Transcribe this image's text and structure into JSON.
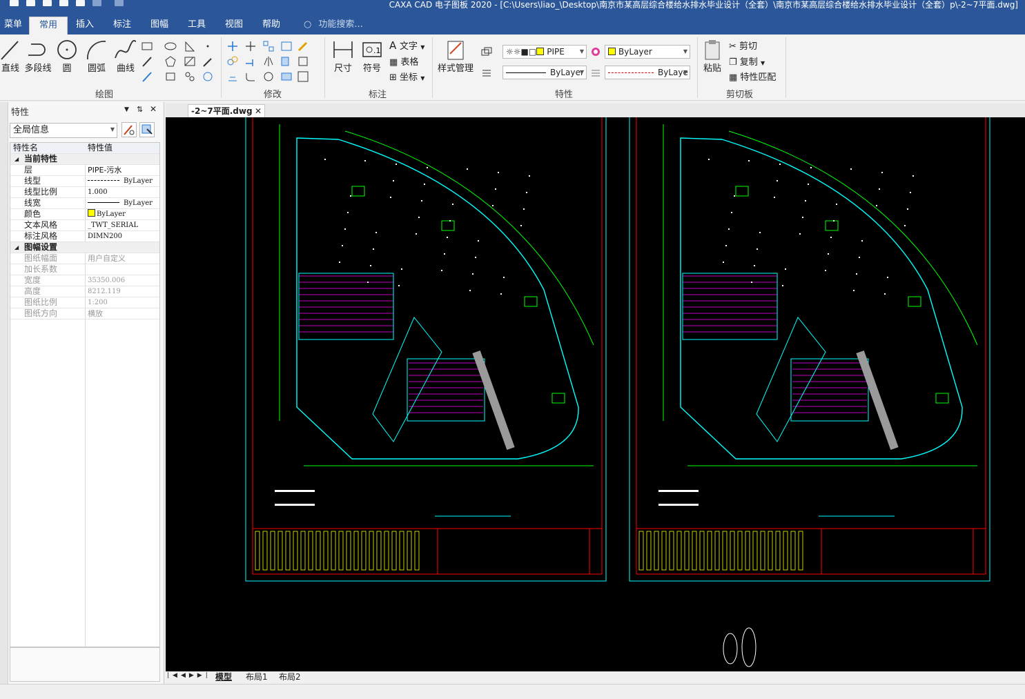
{
  "window": {
    "title": "CAXA CAD 电子图板 2020 - [C:\\Users\\liao_\\Desktop\\南京市某高层综合楼给水排水毕业设计（全套）\\南京市某高层综合楼给水排水毕业设计（全套）p\\-2~7平面.dwg]"
  },
  "menu": {
    "tabs": [
      "菜单",
      "常用",
      "插入",
      "标注",
      "图幅",
      "工具",
      "视图",
      "帮助"
    ],
    "active": "常用",
    "search_placeholder": "功能搜索..."
  },
  "ribbon": {
    "draw": {
      "label": "绘图",
      "tools": [
        "直线",
        "多段线",
        "圆",
        "圆弧",
        "曲线"
      ]
    },
    "modify": {
      "label": "修改"
    },
    "annotate": {
      "label": "标注",
      "dimension": "尺寸",
      "symbol": "符号",
      "text": "文字",
      "table": "表格",
      "coord": "坐标"
    },
    "properties": {
      "label": "特性",
      "style_manager": "样式管理",
      "layer_value": "PIPE",
      "color_value": "ByLayer",
      "linetype_value": "ByLayer",
      "lineweight_value": "ByLaye"
    },
    "clipboard": {
      "label": "剪切板",
      "paste": "粘贴",
      "cut": "剪切",
      "copy": "复制",
      "match": "特性匹配"
    }
  },
  "panel": {
    "title": "特性",
    "scope": "全局信息",
    "col_name": "特性名",
    "col_value": "特性值",
    "sections": [
      {
        "name": "当前特性",
        "rows": [
          {
            "k": "层",
            "v": "PIPE-污水"
          },
          {
            "k": "线型",
            "v": "ByLayer"
          },
          {
            "k": "线型比例",
            "v": "1.000"
          },
          {
            "k": "线宽",
            "v": "ByLayer"
          },
          {
            "k": "颜色",
            "v": "ByLayer"
          },
          {
            "k": "文本风格",
            "v": "_TWT_SERIAL"
          },
          {
            "k": "标注风格",
            "v": "DIMN200"
          }
        ]
      },
      {
        "name": "图幅设置",
        "rows": [
          {
            "k": "图纸幅面",
            "v": "用户自定义"
          },
          {
            "k": "加长系数",
            "v": ""
          },
          {
            "k": "宽度",
            "v": "35350.006"
          },
          {
            "k": "高度",
            "v": "8212.119"
          },
          {
            "k": "图纸比例",
            "v": "1:200"
          },
          {
            "k": "图纸方向",
            "v": "横放"
          }
        ]
      }
    ]
  },
  "document": {
    "tab": "-2~7平面.dwg"
  },
  "layouts": {
    "tabs": [
      "模型",
      "布局1",
      "布局2"
    ],
    "active": "模型"
  },
  "colors": {
    "titlebar": "#2b579a",
    "canvas": "#000000",
    "cyan": "#00ffff",
    "green": "#00ff00",
    "magenta": "#ff00ff",
    "yellow": "#ffff00",
    "red": "#ff0000"
  }
}
